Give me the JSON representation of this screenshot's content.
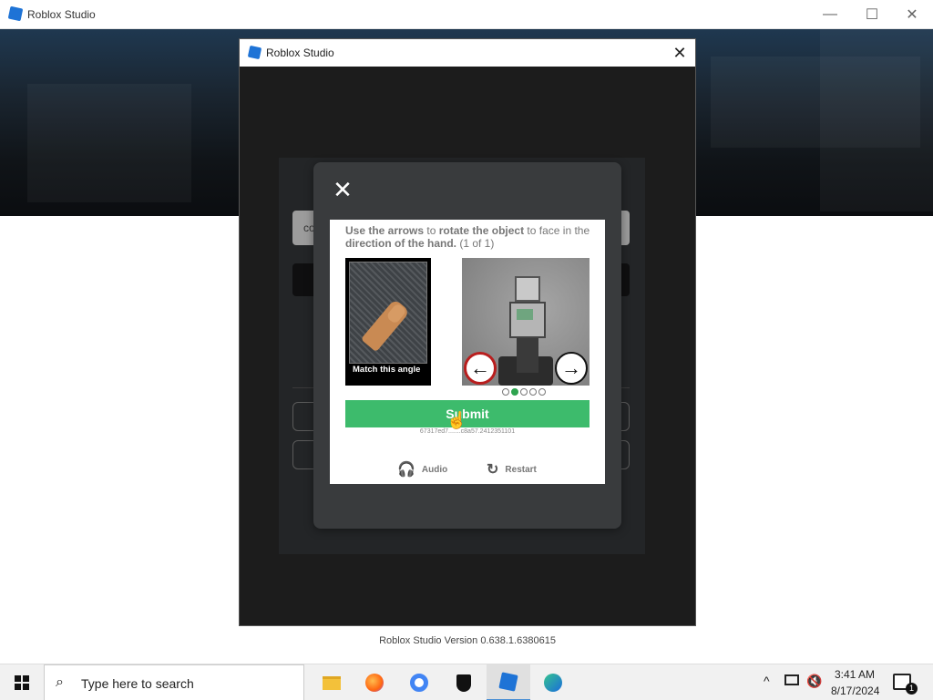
{
  "outer_window": {
    "title": "Roblox Studio",
    "controls": {
      "minimize": "—",
      "maximize": "☐",
      "close": "✕"
    }
  },
  "login_window": {
    "title": "Roblox Studio",
    "close": "✕",
    "background_field_text": "co",
    "version": "Roblox Studio Version 0.638.1.6380615"
  },
  "captcha": {
    "close": "✕",
    "instruction_parts": {
      "p1": "Use the arrows",
      "p2": " to ",
      "p3": "rotate the object",
      "p4": " to face in the ",
      "p5": "direction of the hand.",
      "p6": " (1 of 1)"
    },
    "reference_label": "Match this angle",
    "arrow_left": "←",
    "arrow_right": "→",
    "dots": [
      false,
      true,
      false,
      false,
      false
    ],
    "submit_label": "Submit",
    "session_id": "67317ed7.......c8a57.2412351101",
    "audio_label": "Audio",
    "restart_label": "Restart",
    "icons": {
      "audio": "headphones-icon",
      "restart": "restart-icon"
    }
  },
  "taskbar": {
    "search_placeholder": "Type here to search",
    "time": "3:41 AM",
    "date": "8/17/2024",
    "notification_count": "1",
    "apps": [
      "file-explorer-icon",
      "firefox-icon",
      "chrome-icon",
      "security-icon",
      "roblox-studio-icon",
      "edge-icon"
    ]
  },
  "colors": {
    "submit_green": "#3dbb6c",
    "modal_bg": "#393b3d",
    "accent_blue": "#1e73d6"
  }
}
